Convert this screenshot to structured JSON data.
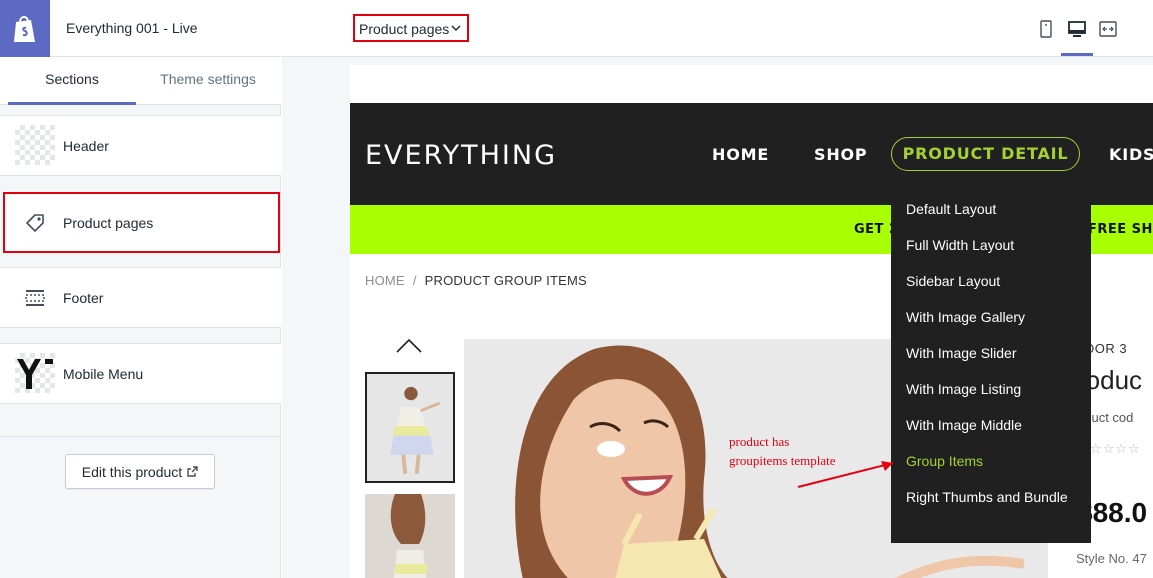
{
  "app": {
    "store_title": "Everything 001 - Live"
  },
  "tabs": {
    "sections": "Sections",
    "theme_settings": "Theme settings"
  },
  "sections": [
    {
      "label": "Header"
    },
    {
      "label": "Product pages"
    },
    {
      "label": "Footer"
    },
    {
      "label": "Mobile Menu"
    }
  ],
  "edit_button": "Edit this product",
  "page_selector": {
    "value": "Product pages"
  },
  "preview": {
    "brand": "EVERYTHING",
    "nav": [
      "HOME",
      "SHOP",
      "PRODUCT DETAIL",
      "KIDS"
    ],
    "promo_left": "GET 2",
    "promo_right": "FREE SHIP",
    "breadcrumb": {
      "home": "HOME",
      "separator": "/",
      "current": "PRODUCT GROUP ITEMS"
    },
    "vendor": "NDOR 3",
    "title": "roduc",
    "code": "oduct cod",
    "stars": "☆☆☆☆",
    "price": "$88.0",
    "style_no": "Style No. 47"
  },
  "dropdown": {
    "items": [
      "Default Layout",
      "Full Width Layout",
      "Sidebar Layout",
      "With Image Gallery",
      "With Image Slider",
      "With Image Listing",
      "With Image Middle",
      "Group Items",
      "Right Thumbs and Bundle"
    ],
    "active": "Group Items"
  },
  "annotation": {
    "line1": "product has",
    "line2": "groupitems template"
  },
  "colors": {
    "shopify_purple": "#5c6ac4",
    "highlight_red": "#e3000f",
    "accent_green": "#a3d130",
    "promo_lime": "#a8ff00",
    "header_dark": "#202020"
  },
  "icons": {
    "logo": "shopify-bag-icon",
    "product_pages": "tag-icon",
    "footer": "footer-layout-icon",
    "external": "external-link-icon",
    "view_mobile": "mobile-view-icon",
    "view_desktop": "desktop-view-icon",
    "view_fullwidth": "fullscreen-view-icon"
  }
}
